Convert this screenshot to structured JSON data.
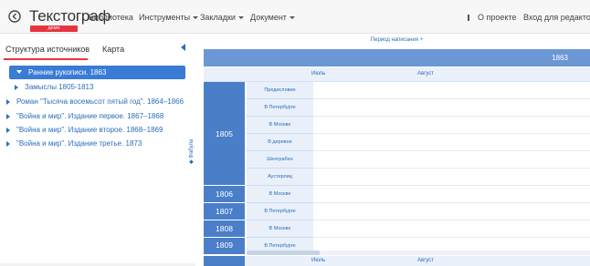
{
  "header": {
    "logo": "Текстограф",
    "badge": "демо",
    "nav": [
      {
        "label": "Библиотека",
        "dropdown": false
      },
      {
        "label": "Инструменты",
        "dropdown": true
      },
      {
        "label": "Закладки",
        "dropdown": true
      },
      {
        "label": "Документ",
        "dropdown": true
      }
    ],
    "about": "О проекте",
    "login": "Вход для редактор"
  },
  "sidebar": {
    "tabs": [
      "Структура источников",
      "Карта"
    ],
    "active_tab": "Структура источников",
    "selected": "Ранние рукописи. 1863",
    "sub_item": "Замыслы 1805-1813",
    "items": [
      "Роман \"Тысяча восемьсот пятый год\". 1864–1866",
      "\"Война и мир\". Издание первое. 1867–1868",
      "\"Война и мир\". Издание второе. 1868–1869",
      "\"Война и мир\". Издание третье. 1873"
    ]
  },
  "timeline": {
    "period_label": "Период написания",
    "side_label": "Фабула",
    "year": "1863",
    "months": [
      "Июль",
      "Август"
    ],
    "rows": [
      {
        "year": "1805",
        "places": [
          "Предисловие",
          "В Петербурге",
          "В Москве",
          "В деревне",
          "Шенграбен",
          "Аустерлиц"
        ]
      },
      {
        "year": "1806",
        "places": [
          "В Москве"
        ]
      },
      {
        "year": "1807",
        "places": [
          "В Петербурге"
        ]
      },
      {
        "year": "1808",
        "places": [
          "В Москве"
        ]
      },
      {
        "year": "1809",
        "places": [
          "В Петербурге"
        ]
      }
    ],
    "bottom_months": [
      "Июль",
      "Август"
    ]
  },
  "colors": {
    "accent": "#e9343e",
    "link": "#2a6ebb",
    "selection": "#3a7bd5",
    "year_cell": "#4a7ec9",
    "year_bar": "#6b97d4"
  }
}
